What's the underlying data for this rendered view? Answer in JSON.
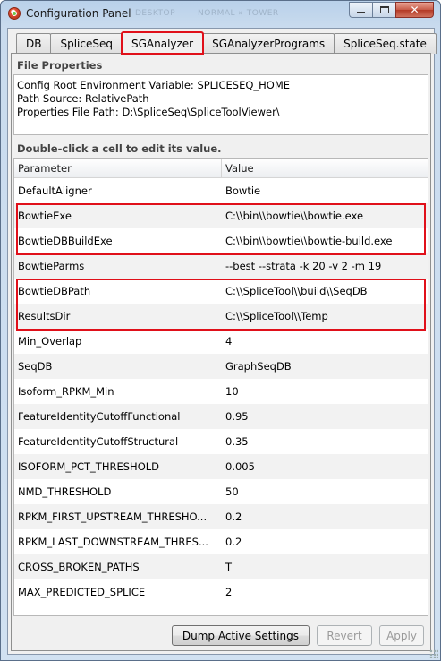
{
  "window": {
    "title": "Configuration Panel",
    "ghost_title": "DESKTOP",
    "ghost_subtitle": "NORMAL » TOWER"
  },
  "tabs": [
    {
      "label": "DB",
      "active": false
    },
    {
      "label": "SpliceSeq",
      "active": false
    },
    {
      "label": "SGAnalyzer",
      "active": true
    },
    {
      "label": "SGAnalyzerPrograms",
      "active": false
    },
    {
      "label": "SpliceSeq.state",
      "active": false
    }
  ],
  "file_properties": {
    "heading": "File Properties",
    "lines": [
      "Config Root Environment Variable: SPLICESEQ_HOME",
      "Path Source: RelativePath",
      "Properties File Path: D:\\SpliceSeq\\SpliceToolViewer\\"
    ]
  },
  "table": {
    "instruction": "Double-click a cell to edit its value.",
    "headers": [
      "Parameter",
      "Value"
    ],
    "rows": [
      {
        "param": "DefaultAligner",
        "value": "Bowtie"
      },
      {
        "param": "BowtieExe",
        "value": "C:\\\\bin\\\\bowtie\\\\bowtie.exe"
      },
      {
        "param": "BowtieDBBuildExe",
        "value": "C:\\\\bin\\\\bowtie\\\\bowtie-build.exe"
      },
      {
        "param": "BowtieParms",
        "value": "--best --strata -k 20 -v 2 -m 19"
      },
      {
        "param": "BowtieDBPath",
        "value": "C:\\\\SpliceTool\\\\build\\\\SeqDB"
      },
      {
        "param": "ResultsDir",
        "value": "C:\\\\SpliceTool\\\\Temp"
      },
      {
        "param": "Min_Overlap",
        "value": "4"
      },
      {
        "param": "SeqDB",
        "value": "GraphSeqDB"
      },
      {
        "param": "Isoform_RPKM_Min",
        "value": "10"
      },
      {
        "param": "FeatureIdentityCutoffFunctional",
        "value": "0.95"
      },
      {
        "param": "FeatureIdentityCutoffStructural",
        "value": "0.35"
      },
      {
        "param": "ISOFORM_PCT_THRESHOLD",
        "value": "0.005"
      },
      {
        "param": "NMD_THRESHOLD",
        "value": "50"
      },
      {
        "param": "RPKM_FIRST_UPSTREAM_THRESHO...",
        "value": "0.2"
      },
      {
        "param": "RPKM_LAST_DOWNSTREAM_THRES...",
        "value": "0.2"
      },
      {
        "param": "CROSS_BROKEN_PATHS",
        "value": "T"
      },
      {
        "param": "MAX_PREDICTED_SPLICE",
        "value": "2"
      }
    ]
  },
  "buttons": {
    "dump": "Dump Active Settings",
    "revert": "Revert",
    "apply": "Apply"
  },
  "caption": {
    "min": "minimize-icon",
    "max": "maximize-icon",
    "close": "close-icon",
    "close_glyph": "✕"
  },
  "colors": {
    "highlight": "#e0101a"
  }
}
